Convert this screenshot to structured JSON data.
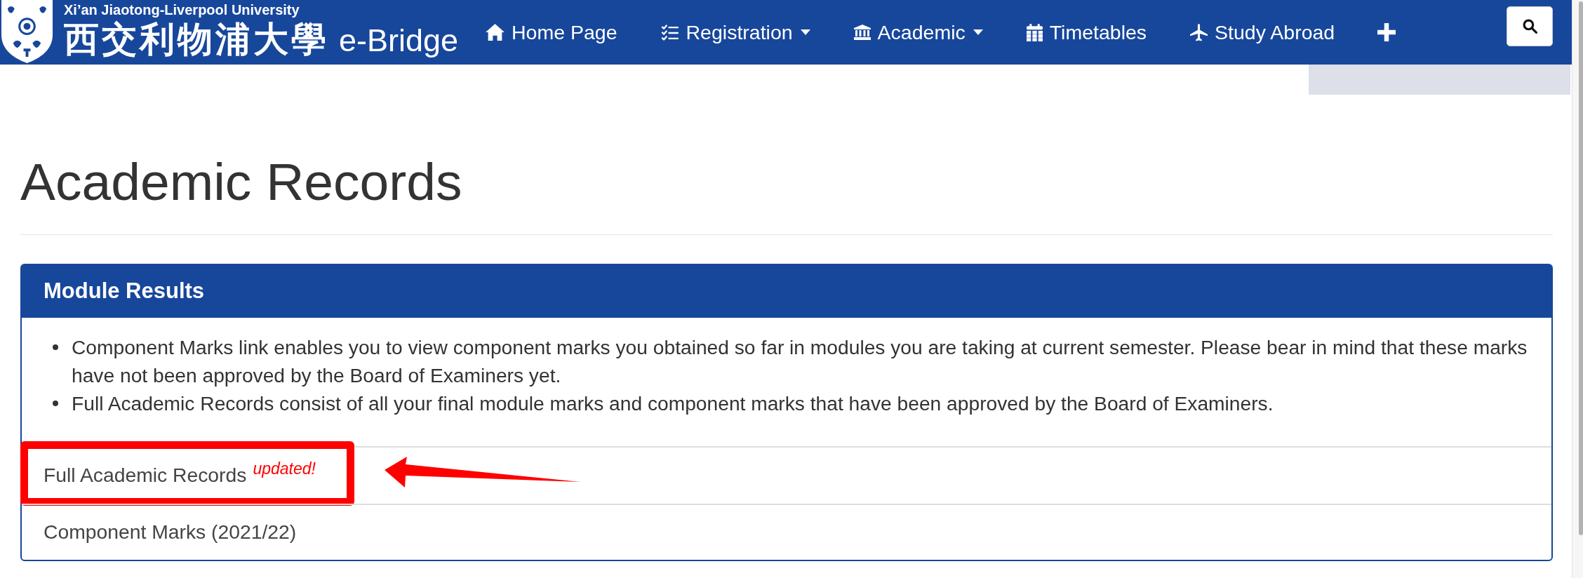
{
  "header": {
    "university": "Xi’an Jiaotong-Liverpool University",
    "university_chinese": "西交利物浦大學",
    "portal": "e-Bridge"
  },
  "nav": {
    "items": [
      {
        "label": "Home Page",
        "dropdown": false
      },
      {
        "label": "Registration",
        "dropdown": true
      },
      {
        "label": "Academic",
        "dropdown": true
      },
      {
        "label": "Timetables",
        "dropdown": false
      },
      {
        "label": "Study Abroad",
        "dropdown": false
      }
    ]
  },
  "page": {
    "title": "Academic Records"
  },
  "panel": {
    "title": "Module Results",
    "notes": [
      "Component Marks link enables you to view component marks you obtained so far in modules you are taking at current semester. Please bear in mind that these marks have not been approved by the Board of Examiners yet.",
      "Full Academic Records consist of all your final module marks and component marks that have been approved by the Board of Examiners."
    ],
    "links": [
      {
        "label": "Full Academic Records",
        "badge": "updated!",
        "highlighted": true
      },
      {
        "label": "Component Marks (2021/22)",
        "highlighted": false
      }
    ]
  }
}
